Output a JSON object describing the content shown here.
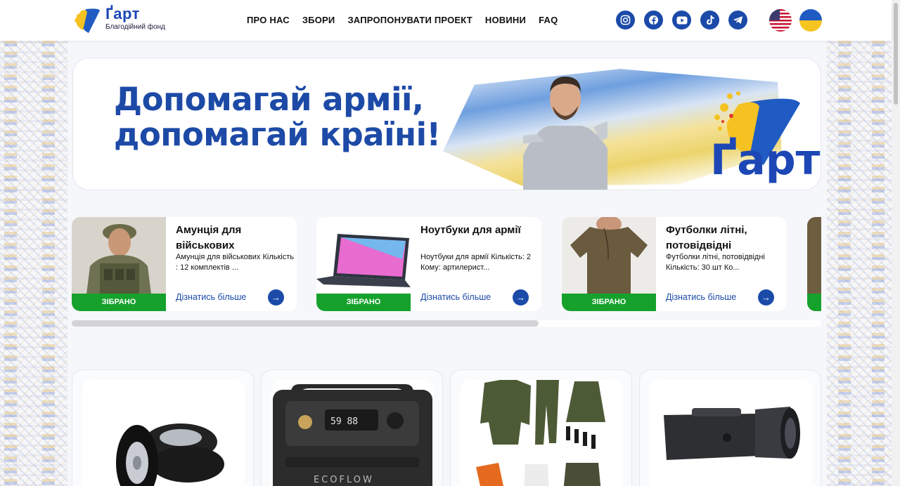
{
  "header": {
    "logo_name": "Ґарт",
    "logo_sub": "Благодійний фонд",
    "nav": [
      "ПРО НАС",
      "ЗБОРИ",
      "ЗАПРОПОНУВАТИ ПРОЕКТ",
      "НОВИНИ",
      "FAQ"
    ],
    "social_icons": [
      "instagram-icon",
      "facebook-icon",
      "youtube-icon",
      "tiktok-icon",
      "telegram-icon"
    ],
    "languages": [
      "en",
      "uk"
    ]
  },
  "hero": {
    "line1": "Допомагай армії,",
    "line2": "допомагай країні!",
    "logo_text": "Ґарт"
  },
  "carousel": {
    "items": [
      {
        "title": "Амунція для військових",
        "desc": "Амунція для військових Кількість : 12 комплектів ...",
        "badge": "ЗІБРАНО",
        "link": "Дізнатись більше"
      },
      {
        "title": "Ноутбуки для армії",
        "desc": "Ноутбуки для армії Кількість: 2 Кому: артилерист...",
        "badge": "ЗІБРАНО",
        "link": "Дізнатись більше"
      },
      {
        "title": "Футболки літні, потовідвідні",
        "desc": "Футболки літні, потовідвідні Кількість: 30 шт Ко...",
        "badge": "ЗІБРАНО",
        "link": "Дізнатись більше"
      }
    ]
  },
  "grid": {
    "items": [
      "tires",
      "power-station",
      "thermal-clothing",
      "thermal-monocular"
    ],
    "power_station_brand": "ECOFLOW"
  },
  "colors": {
    "brand_blue": "#1b4aa8",
    "collected_green": "#16a12c",
    "flag_yellow": "#f7c521"
  }
}
